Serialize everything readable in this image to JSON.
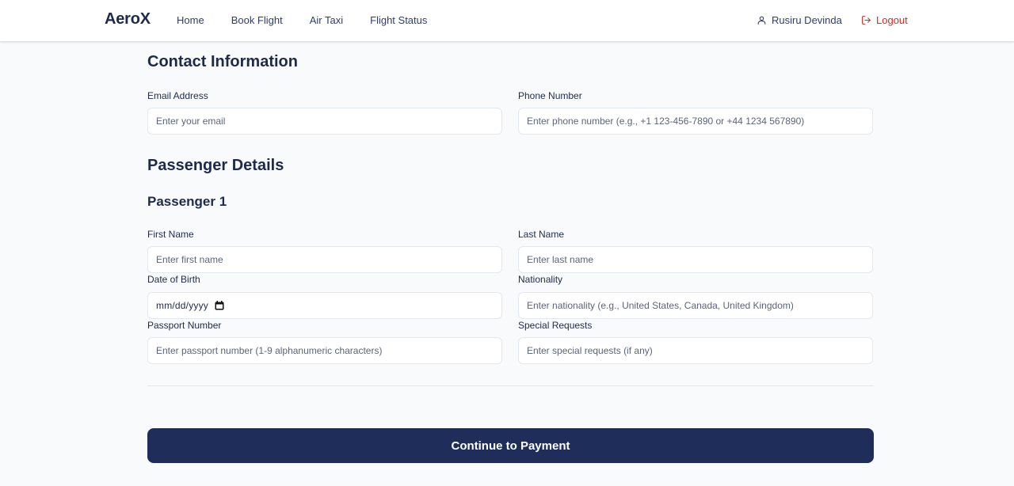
{
  "nav": {
    "brand": "AeroX",
    "links": [
      "Home",
      "Book Flight",
      "Air Taxi",
      "Flight Status"
    ],
    "user_name": "Rusiru Devinda",
    "logout_label": "Logout"
  },
  "contact": {
    "title": "Contact Information",
    "email_label": "Email Address",
    "email_placeholder": "Enter your email",
    "phone_label": "Phone Number",
    "phone_placeholder": "Enter phone number (e.g., +1 123-456-7890 or +44 1234 567890)"
  },
  "passenger_section": {
    "title": "Passenger Details",
    "passenger_title": "Passenger 1",
    "first_name_label": "First Name",
    "first_name_placeholder": "Enter first name",
    "last_name_label": "Last Name",
    "last_name_placeholder": "Enter last name",
    "dob_label": "Date of Birth",
    "dob_value": "mm/dd/yyyy",
    "nationality_label": "Nationality",
    "nationality_placeholder": "Enter nationality (e.g., United States, Canada, United Kingdom)",
    "passport_label": "Passport Number",
    "passport_placeholder": "Enter passport number (1-9 alphanumeric characters)",
    "requests_label": "Special Requests",
    "requests_placeholder": "Enter special requests (if any)"
  },
  "submit_label": "Continue to Payment",
  "colors": {
    "primary": "#1e2d59",
    "logout": "#dc2626",
    "background": "#f8fafc",
    "text": "#1e2a4a"
  },
  "icons": {
    "user": "user-icon",
    "logout": "logout-icon",
    "calendar": "calendar-icon"
  }
}
